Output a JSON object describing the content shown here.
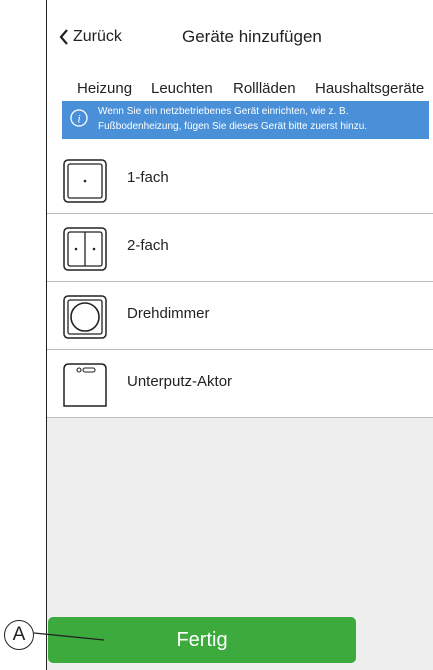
{
  "header": {
    "back_label": "Zurück",
    "title": "Geräte hinzufügen"
  },
  "tabs": [
    {
      "label": "Heizung",
      "selected": false
    },
    {
      "label": "Leuchten",
      "selected": true
    },
    {
      "label": "Rollläden",
      "selected": false
    },
    {
      "label": "Haushaltsgeräte",
      "selected": false
    }
  ],
  "info": {
    "line1": "Wenn Sie ein netzbetriebenes Gerät einrichten, wie z. B.",
    "line2": "Fußbodenheizung, fügen Sie dieses Gerät bitte zuerst hinzu."
  },
  "devices": [
    {
      "label": "1-fach",
      "icon": "single-switch-icon"
    },
    {
      "label": "2-fach",
      "icon": "double-switch-icon"
    },
    {
      "label": "Drehdimmer",
      "icon": "rotary-dimmer-icon"
    },
    {
      "label": "Unterputz-Aktor",
      "icon": "flush-actuator-icon"
    }
  ],
  "done_label": "Fertig",
  "callout_label": "A",
  "colors": {
    "accent_green": "#3daa3d",
    "info_blue": "#4a90d9",
    "bottom_gray": "#eeeeee"
  }
}
